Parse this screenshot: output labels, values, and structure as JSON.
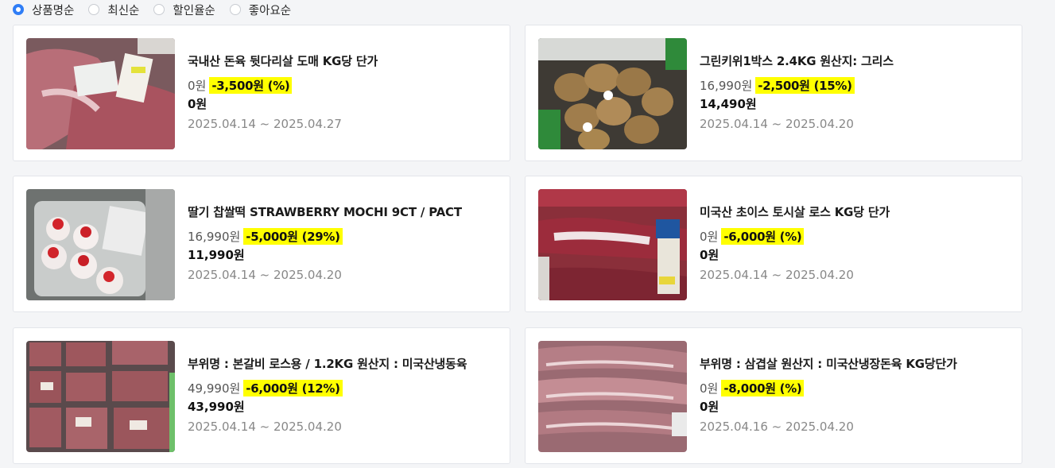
{
  "sort_options": [
    {
      "label": "상품명순",
      "checked": true
    },
    {
      "label": "최신순",
      "checked": false
    },
    {
      "label": "할인율순",
      "checked": false
    },
    {
      "label": "좋아요순",
      "checked": false
    }
  ],
  "products": [
    {
      "title": "국내산 돈육 뒷다리살 도매 KG당 단가",
      "original_price": "0원",
      "discount": "-3,500원 (%)",
      "final_price": "0원",
      "period": "2025.04.14 ~ 2025.04.27",
      "image": "pork-leg-icon"
    },
    {
      "title": "그린키위1박스 2.4KG 원산지: 그리스",
      "original_price": "16,990원",
      "discount": "-2,500원 (15%)",
      "final_price": "14,490원",
      "period": "2025.04.14 ~ 2025.04.20",
      "image": "kiwi-box-icon"
    },
    {
      "title": "딸기 찹쌀떡 STRAWBERRY MOCHI 9CT / PACT",
      "original_price": "16,990원",
      "discount": "-5,000원 (29%)",
      "final_price": "11,990원",
      "period": "2025.04.14 ~ 2025.04.20",
      "image": "strawberry-mochi-icon"
    },
    {
      "title": "미국산 초이스 토시살 로스 KG당 단가",
      "original_price": "0원",
      "discount": "-6,000원 (%)",
      "final_price": "0원",
      "period": "2025.04.14 ~ 2025.04.20",
      "image": "beef-hanger-icon"
    },
    {
      "title": "부위명 : 본갈비 로스용 / 1.2KG 원산지 : 미국산냉동육",
      "original_price": "49,990원",
      "discount": "-6,000원 (12%)",
      "final_price": "43,990원",
      "period": "2025.04.14 ~ 2025.04.20",
      "image": "beef-rib-packs-icon"
    },
    {
      "title": "부위명 : 삼겹살 원산지 : 미국산냉장돈육 KG당단가",
      "original_price": "0원",
      "discount": "-8,000원 (%)",
      "final_price": "0원",
      "period": "2025.04.16 ~ 2025.04.20",
      "image": "pork-belly-icon"
    }
  ]
}
